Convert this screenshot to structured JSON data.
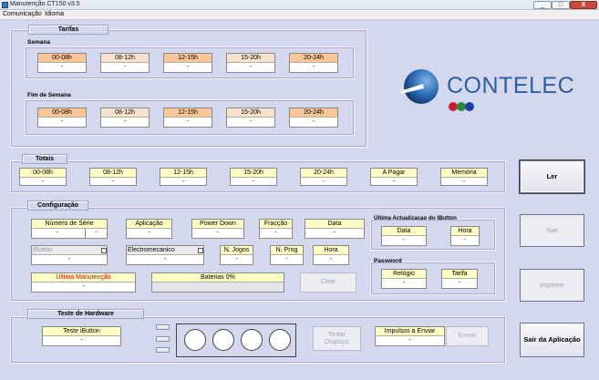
{
  "window": {
    "title": "Manutenção CT150 v3.5",
    "controls": [
      "_",
      "□",
      "X"
    ]
  },
  "menu": {
    "items": [
      "Comunicação",
      "Idioma"
    ]
  },
  "tarifas": {
    "title": "Tarifas",
    "semana": {
      "label": "Semana",
      "slots": [
        {
          "label": "00-08h",
          "value": "-"
        },
        {
          "label": "08-12h",
          "value": "-"
        },
        {
          "label": "12-15h",
          "value": "-"
        },
        {
          "label": "15-20h",
          "value": "-"
        },
        {
          "label": "20-24h",
          "value": "-"
        }
      ]
    },
    "fim_de_semana": {
      "label": "Fim de Semana",
      "slots": [
        {
          "label": "00-08h",
          "value": "-"
        },
        {
          "label": "08-12h",
          "value": "-"
        },
        {
          "label": "12-15h",
          "value": "-"
        },
        {
          "label": "15-20h",
          "value": "-"
        },
        {
          "label": "20-24h",
          "value": "-"
        }
      ]
    }
  },
  "logo": {
    "text": "CONTELEC",
    "dot_colors": [
      "#c7202e",
      "#2e8b3e",
      "#1f3fa6"
    ],
    "accent": "#2a6ab0"
  },
  "totais": {
    "title": "Totais",
    "fields": [
      {
        "label": "00-08h",
        "value": "-"
      },
      {
        "label": "08-12h",
        "value": "-"
      },
      {
        "label": "12-15h",
        "value": "-"
      },
      {
        "label": "15-20h",
        "value": "-"
      },
      {
        "label": "20-24h",
        "value": "-"
      },
      {
        "label": "A Pagar",
        "value": "-"
      },
      {
        "label": "Memória",
        "value": "-"
      }
    ]
  },
  "configuracao": {
    "title": "Configuração",
    "numero_serie": {
      "label": "Número de Série",
      "value1": "-",
      "value2": "-"
    },
    "aplicacao": {
      "label": "Aplicação",
      "value": "-"
    },
    "power_down": {
      "label": "Power Down",
      "value": "-"
    },
    "fraccao": {
      "label": "Fracção",
      "value": "-"
    },
    "data": {
      "label": "Data",
      "value": "-"
    },
    "ibutton": {
      "label": "iButton",
      "value": "-"
    },
    "electromecanico": {
      "label": "Electromecanico",
      "value": "-"
    },
    "n_jogos": {
      "label": "N. Jogos",
      "value": "-"
    },
    "n_prog": {
      "label": "N. Prog",
      "value": "-"
    },
    "hora": {
      "label": "Hora",
      "value": "-"
    },
    "ultima_manutencao": {
      "label": "Última Manutenção",
      "value": "-"
    },
    "baterias": {
      "label": "Baterias",
      "value": "0%"
    },
    "clear_label": "Clear",
    "ultima_actualizacao": {
      "title": "Última Actualizacao do iButton",
      "data": {
        "label": "Data",
        "value": "-"
      },
      "hora": {
        "label": "Hora",
        "value": "-"
      }
    },
    "password": {
      "title": "Password",
      "relogio": {
        "label": "Relógio",
        "value": "-"
      },
      "tarifa": {
        "label": "Tarifa",
        "value": "-"
      }
    }
  },
  "teste_hardware": {
    "title": "Teste de Hardware",
    "teste_ibutton": {
      "label": "Teste iButton",
      "value": "-"
    },
    "testar_displays": "Testar Displays",
    "impulsos": {
      "label": "Impulsos a Enviar",
      "value": "-"
    },
    "enviar": "Enviar"
  },
  "buttons": {
    "ler": "Ler",
    "sair": "Sair",
    "imprimir": "Imprimir",
    "sair_aplicacao": "Sair da Aplicação"
  }
}
